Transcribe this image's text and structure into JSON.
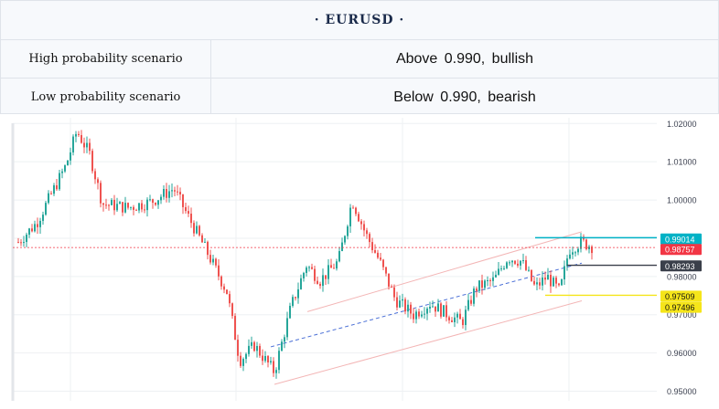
{
  "header": {
    "title": "· EURUSD ·"
  },
  "scenarios": [
    {
      "label": "High probability scenario",
      "value": "Above  0.990,  bullish"
    },
    {
      "label": "Low probability scenario",
      "value": "Below  0.990,  bearish"
    }
  ],
  "chart_data": {
    "type": "candlestick",
    "y_ticks": [
      "1.02000",
      "1.01000",
      "1.00000",
      "0.99000",
      "0.98000",
      "0.97000",
      "0.96000",
      "0.95000"
    ],
    "ylim": [
      0.9475,
      1.0215
    ],
    "grid": true,
    "price_tags": [
      {
        "label": "0.99014",
        "value": 0.99014,
        "color": "#00b2c6",
        "line": true,
        "dashed": false
      },
      {
        "label": "0.98757",
        "value": 0.98757,
        "color": "#f23645",
        "line": true,
        "dashed": true
      },
      {
        "label": "0.98293",
        "value": 0.98293,
        "color": "#3a3f4a",
        "line": true,
        "dashed": false
      },
      {
        "label": "0.97509",
        "value": 0.97509,
        "color": "#f5e51a",
        "line": true,
        "dashed": false
      },
      {
        "label": "0.97496",
        "value": 0.97496,
        "color": "#f5e51a",
        "line": false,
        "dashed": false
      }
    ],
    "colors": {
      "up": "#26a69a",
      "down": "#ef5350",
      "channel": "#f3b5b5",
      "midline": "#4a6fd6"
    }
  }
}
